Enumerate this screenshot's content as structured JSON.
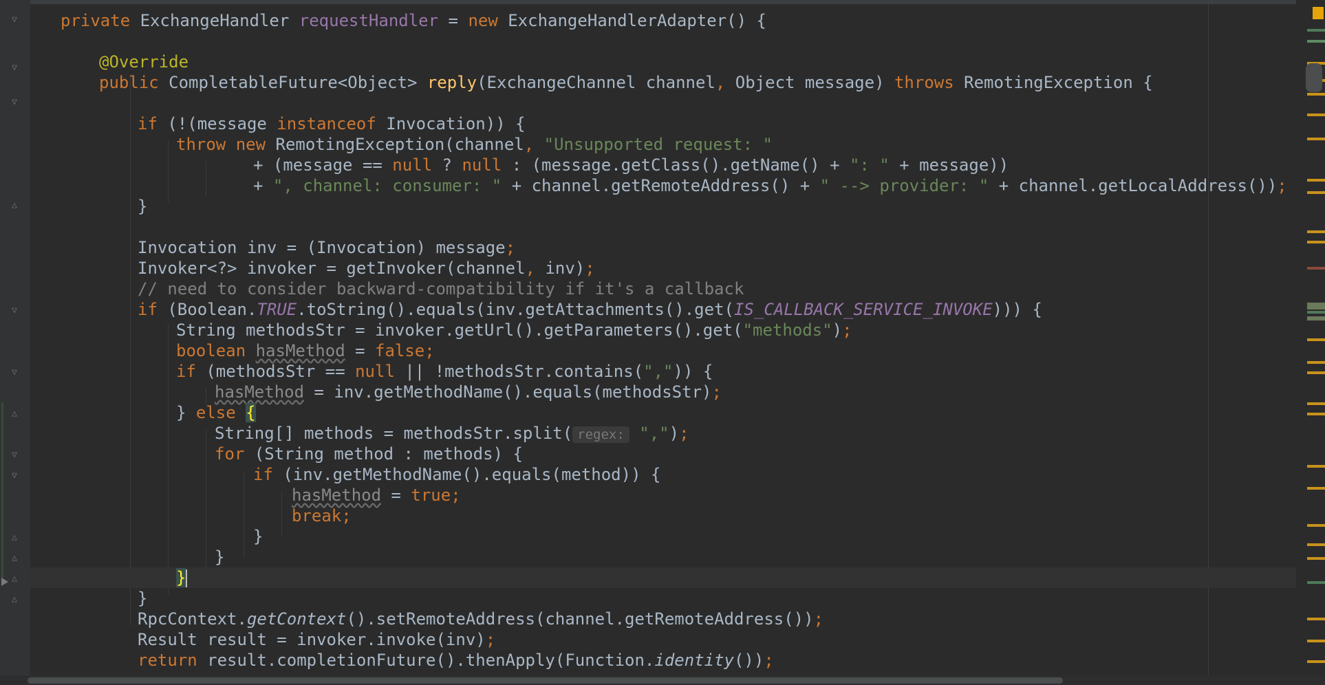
{
  "editor": {
    "lines": {
      "l1": {
        "a": "private ",
        "b": "ExchangeHandler ",
        "c": "requestHandler",
        "d": " = ",
        "e": "new ",
        "f": "ExchangeHandlerAdapter() {"
      },
      "l2": {
        "a": "@Override"
      },
      "l3": {
        "a": "public ",
        "b": "CompletableFuture<Object> ",
        "c": "reply",
        "d": "(ExchangeChannel channel",
        "e": ", ",
        "f": "Object message) ",
        "g": "throws ",
        "h": "RemotingException {"
      },
      "l4": {
        "a": "if ",
        "b": "(!(message ",
        "c": "instanceof ",
        "d": "Invocation)) {"
      },
      "l5": {
        "a": "throw new ",
        "b": "RemotingException(channel",
        "c": ", ",
        "d": "\"Unsupported request: \""
      },
      "l6": {
        "a": "+ (message == ",
        "b": "null ",
        "c": "? ",
        "d": "null ",
        "e": ": (message.getClass().getName() + ",
        "f": "\": \" ",
        "g": "+ message))"
      },
      "l7": {
        "a": "+ ",
        "b": "\", channel: consumer: \" ",
        "c": "+ channel.getRemoteAddress() + ",
        "d": "\" --> provider: \" ",
        "e": "+ channel.getLocalAddress())",
        "f": ";"
      },
      "l8": {
        "a": "}"
      },
      "l9": {
        "a": "Invocation inv = (Invocation) message",
        "b": ";"
      },
      "l10": {
        "a": "Invoker<?> invoker = getInvoker(channel",
        "b": ", ",
        "c": "inv)",
        "d": ";"
      },
      "l11": {
        "a": "// need to consider backward-compatibility if it's a callback"
      },
      "l12": {
        "a": "if ",
        "b": "(Boolean.",
        "c": "TRUE",
        "d": ".toString().equals(inv.getAttachments().get(",
        "e": "IS_CALLBACK_SERVICE_INVOKE",
        "f": "))) {"
      },
      "l13": {
        "a": "String methodsStr = invoker.getUrl().getParameters().get(",
        "b": "\"methods\"",
        "c": ")",
        "d": ";"
      },
      "l14": {
        "a": "boolean ",
        "b": "hasMethod",
        "c": " = ",
        "d": "false",
        "e": ";"
      },
      "l15": {
        "a": "if ",
        "b": "(methodsStr == ",
        "c": "null ",
        "d": "|| !methodsStr.contains(",
        "e": "\",\"",
        "f": ")) {"
      },
      "l16": {
        "a": "hasMethod",
        "b": " = inv.getMethodName().equals(methodsStr)",
        "c": ";"
      },
      "l17": {
        "a": "} ",
        "b": "else ",
        "c": "{"
      },
      "l18": {
        "a": "String[] methods = methodsStr.split(",
        "hint": "regex:",
        "b": "\",\"",
        "c": ")",
        "d": ";"
      },
      "l19": {
        "a": "for ",
        "b": "(String method : methods) {"
      },
      "l20": {
        "a": "if ",
        "b": "(inv.getMethodName().equals(method)) {"
      },
      "l21": {
        "a": "hasMethod",
        "b": " = ",
        "c": "true",
        "d": ";"
      },
      "l22": {
        "a": "break",
        "b": ";"
      },
      "l23": {
        "a": "}"
      },
      "l24": {
        "a": "}"
      },
      "l25": {
        "a": "}"
      },
      "l26": {
        "a": "}"
      },
      "l27": {
        "a": "RpcContext.",
        "b": "getContext",
        "c": "().setRemoteAddress(channel.getRemoteAddress())",
        "d": ";"
      },
      "l28": {
        "a": "Result result = invoker.invoke(inv)",
        "b": ";"
      },
      "l29": {
        "a": "return ",
        "b": "result.completionFuture().thenApply(Function.",
        "c": "identity",
        "d": "())",
        "e": ";"
      }
    }
  },
  "colors": {
    "background": "#2b2b2b",
    "keyword": "#cc7832",
    "string": "#6a8759",
    "annotation": "#bbb529",
    "field": "#9876aa",
    "comment": "#808080",
    "method_declaration": "#ffc66d",
    "brace_highlight": "#ffef28"
  },
  "icons": {
    "fold": "fold-arrow-icon",
    "inspection": "inspection-warning-icon"
  }
}
